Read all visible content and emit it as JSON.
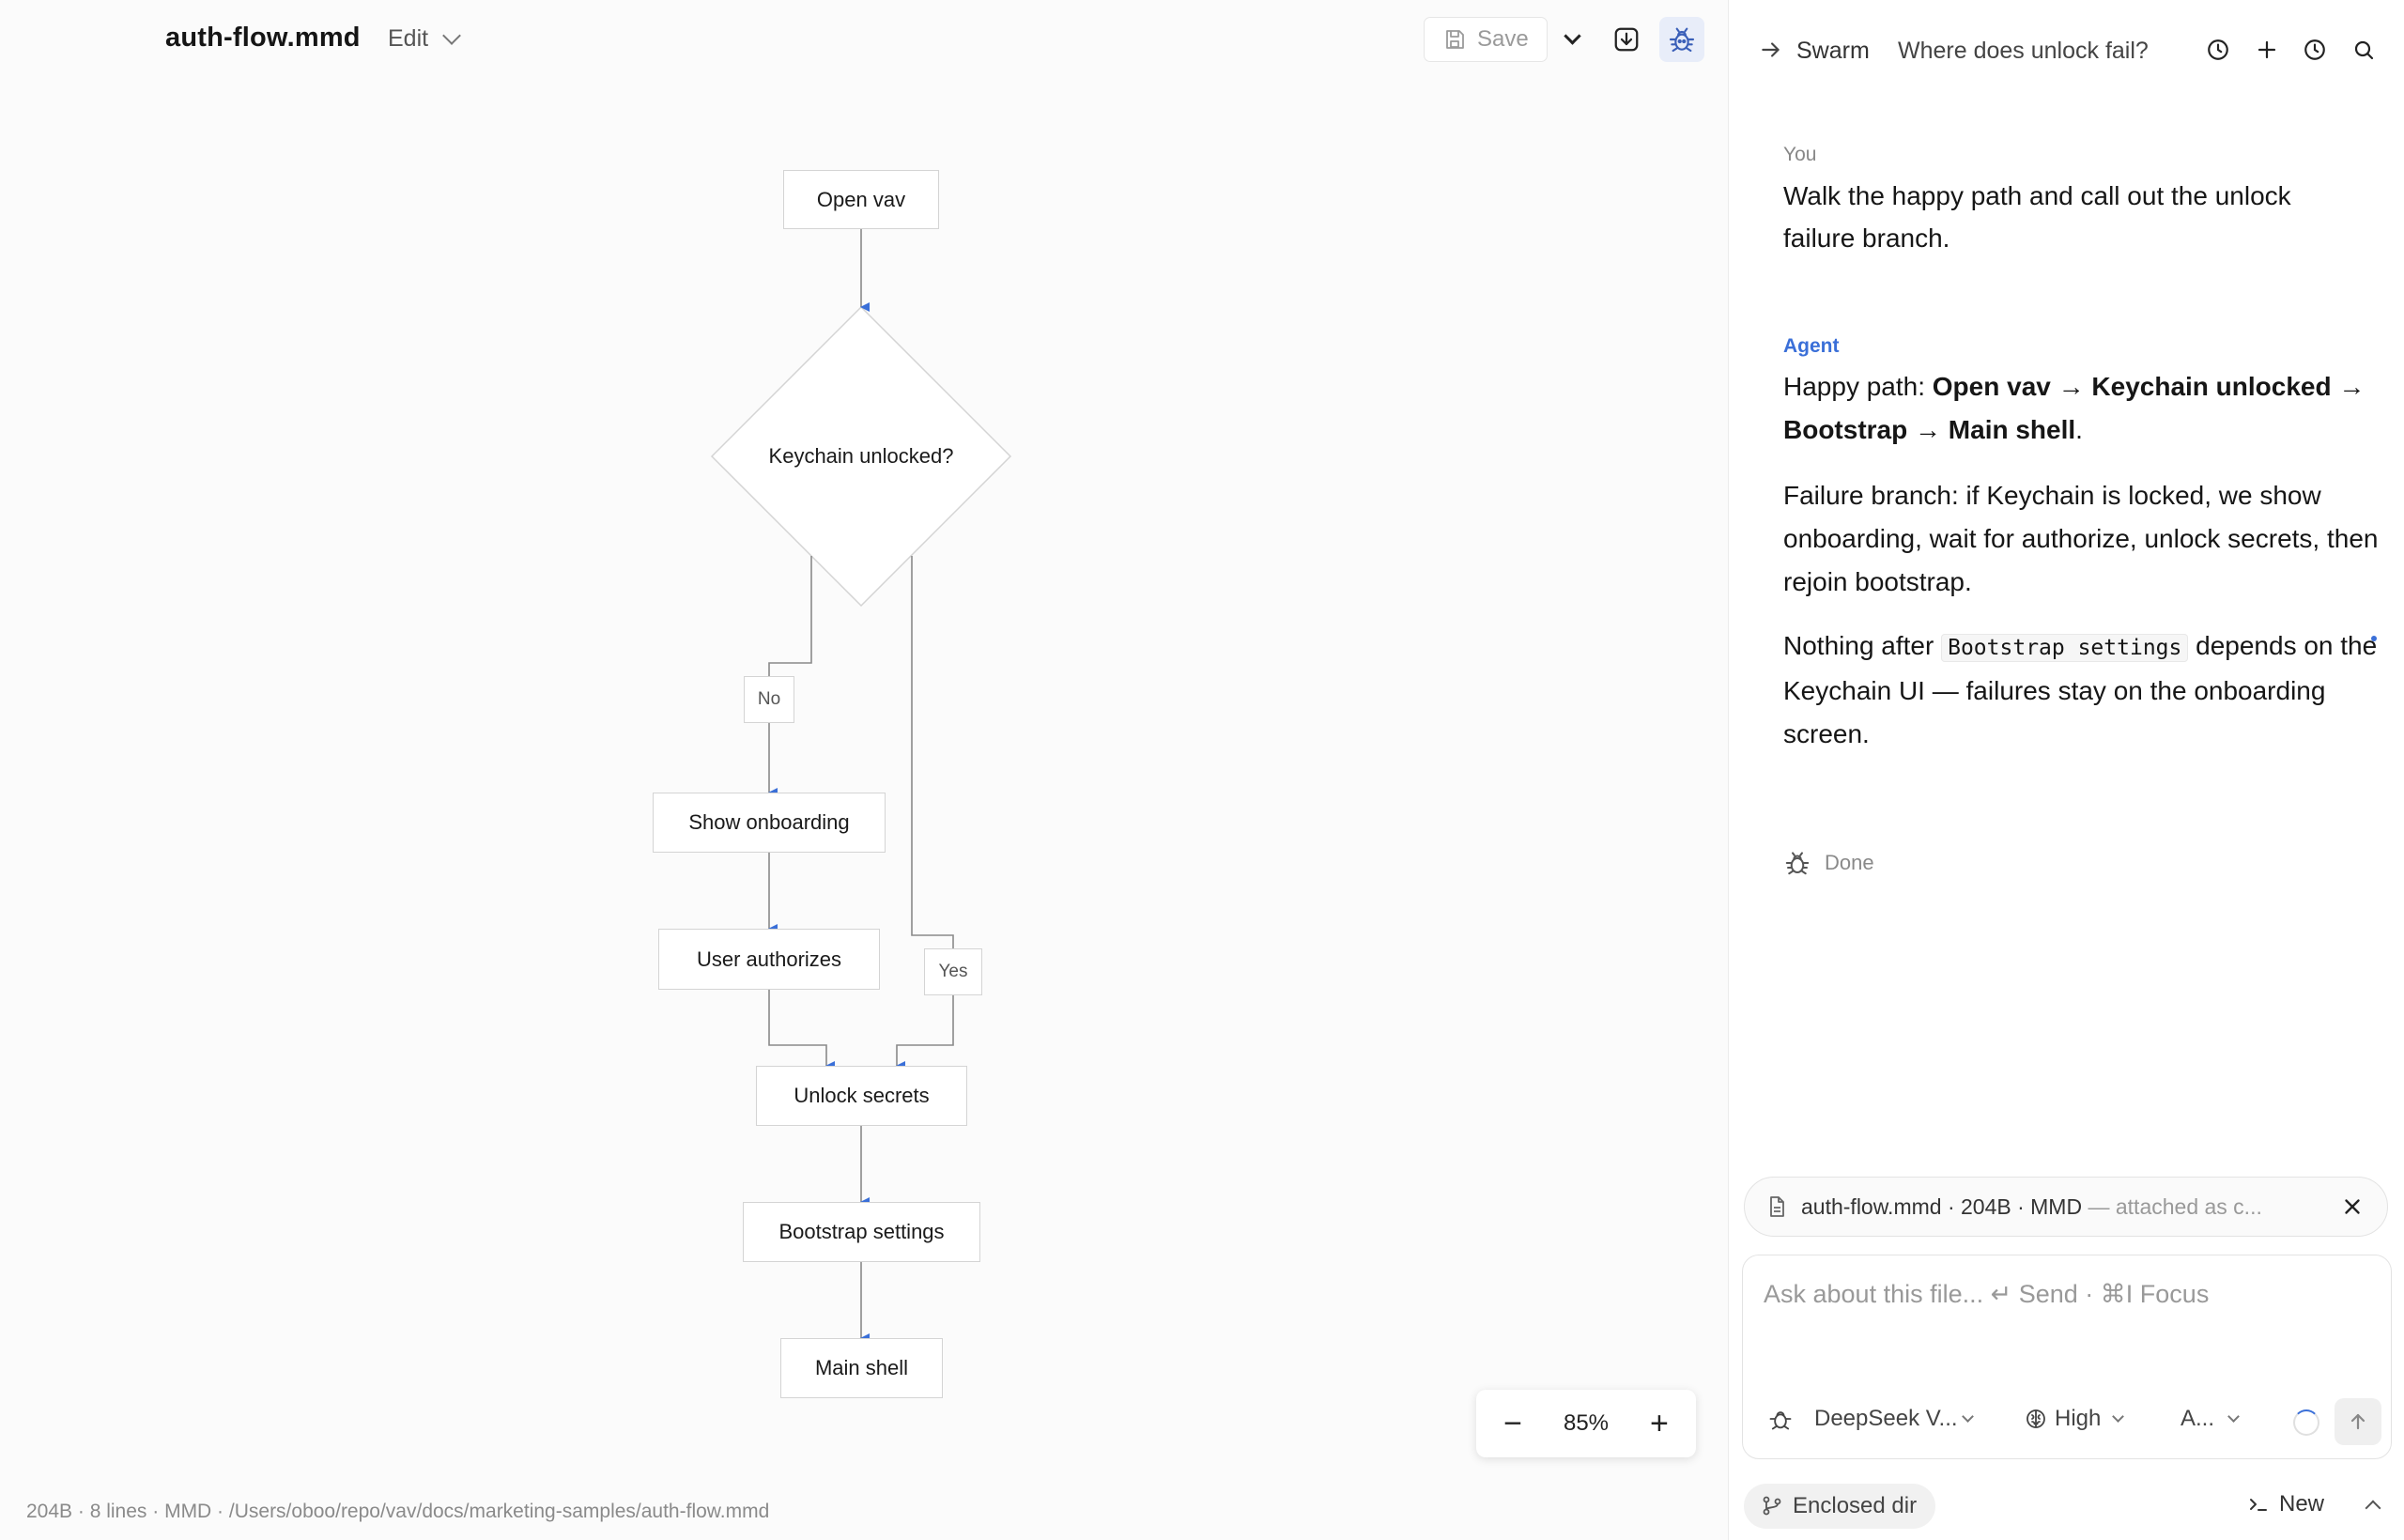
{
  "editor": {
    "file_title": "auth-flow.mmd",
    "mode_label": "Edit",
    "save_label": "Save",
    "zoom": "85%",
    "zoom_out": "−",
    "zoom_in": "+",
    "status": "204B · 8 lines · MMD · /Users/oboo/repo/vav/docs/marketing-samples/auth-flow.mmd"
  },
  "diagram": {
    "nodes": {
      "open_vav": "Open vav",
      "keychain": "Keychain unlocked?",
      "show_onboarding": "Show onboarding",
      "user_authorizes": "User authorizes",
      "unlock_secrets": "Unlock secrets",
      "bootstrap": "Bootstrap settings",
      "main_shell": "Main shell"
    },
    "edge_labels": {
      "no": "No",
      "yes": "Yes"
    },
    "colors": {
      "edge": "#8a8a8a",
      "arrowhead": "#3a6fd8",
      "node_border": "#d4d4d4"
    }
  },
  "chat": {
    "header": {
      "swarm": "Swarm",
      "title": "Where does unlock fail?"
    },
    "you_label": "You",
    "user_message": "Walk the happy path and call out the unlock failure branch.",
    "agent_label": "Agent",
    "agent": {
      "p1_prefix": "Happy path: ",
      "p1_step1": "Open vav",
      "p1_step2": "Keychain unlocked",
      "p1_step3": "Bootstrap",
      "p1_step4": "Main shell",
      "arrow": " → ",
      "p1_suffix": ".",
      "p2": "Failure branch: if Keychain is locked, we show onboarding, wait for authorize, unlock secrets, then rejoin bootstrap.",
      "p3_prefix": "Nothing after ",
      "p3_code": "Bootstrap settings",
      "p3_suffix": " depends on the Keychain UI — failures stay on the onboarding screen."
    },
    "status": "Done",
    "attachment": {
      "name": "auth-flow.mmd · 204B · MMD",
      "note": " — attached as c..."
    },
    "composer": {
      "placeholder": "Ask about this file...  ↵ Send · ⌘I Focus",
      "model": "DeepSeek V...",
      "effort": "High",
      "mode": "A..."
    },
    "footer": {
      "dir": "Enclosed dir",
      "new": "New"
    },
    "colors": {
      "accent": "#3a6fd8"
    }
  }
}
